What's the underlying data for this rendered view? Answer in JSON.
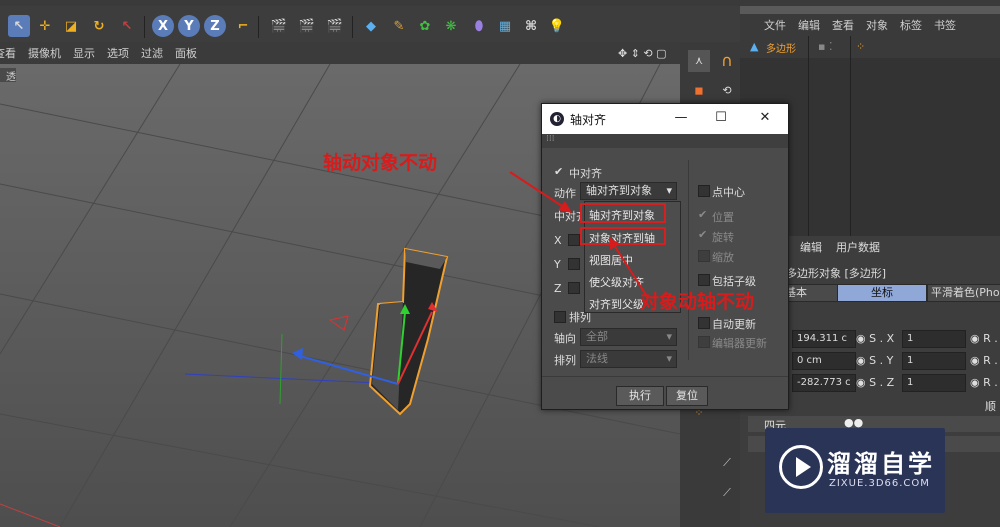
{
  "toolbar": {
    "axis_buttons": [
      "X",
      "Y",
      "Z"
    ]
  },
  "viewport": {
    "menu": [
      "查看",
      "摄像机",
      "显示",
      "选项",
      "过滤",
      "面板"
    ],
    "view_label": "透视图"
  },
  "object_manager": {
    "menu": [
      "文件",
      "编辑",
      "查看",
      "对象",
      "标签",
      "书签"
    ],
    "object_name": "多边形"
  },
  "attribute_manager": {
    "menu": [
      "编辑",
      "用户数据"
    ],
    "object_title": "多边形对象 [多边形]",
    "tabs": [
      "基本",
      "坐标",
      "平滑着色(Phon"
    ],
    "rows": [
      {
        "p": "194.311 c",
        "s_label": "S . X",
        "s_val": "1",
        "r": "R ."
      },
      {
        "p": "0 cm",
        "s_label": "S . Y",
        "s_val": "1",
        "r": "R ."
      },
      {
        "p": "-282.773 c",
        "s_label": "S . Z",
        "s_val": "1",
        "r": "R ."
      }
    ],
    "quaternion_label": "四元",
    "order_label": "顺"
  },
  "dialog": {
    "title": "轴对齐",
    "center_align_label": "中对齐",
    "action_label": "动作",
    "action_value": "轴对齐到对象",
    "center_label": "中对齐",
    "axes": [
      "X",
      "Y",
      "Z"
    ],
    "menu_items": [
      "轴对齐到对象",
      "对象对齐到轴",
      "视图居中",
      "使父级对齐",
      "对齐到父级"
    ],
    "arrange_label": "排列",
    "axis_label": "轴向",
    "axis_value": "全部",
    "arrange2_label": "排列",
    "arrange2_value": "法线",
    "right_options": [
      "点中心",
      "位置",
      "旋转",
      "缩放",
      "包括子级",
      "自动更新",
      "编辑器更新"
    ],
    "execute": "执行",
    "reset": "复位"
  },
  "annotations": {
    "top": "轴动对象不动",
    "bottom": "对象动轴不动"
  },
  "watermark": {
    "name": "溜溜自学",
    "url": "ZIXUE.3D66.COM"
  },
  "colors": {
    "accent_red": "#d61c1c",
    "selection_orange": "#f0a030",
    "axis_x": "#e03030",
    "axis_y": "#30c030",
    "axis_z": "#3060e0"
  }
}
